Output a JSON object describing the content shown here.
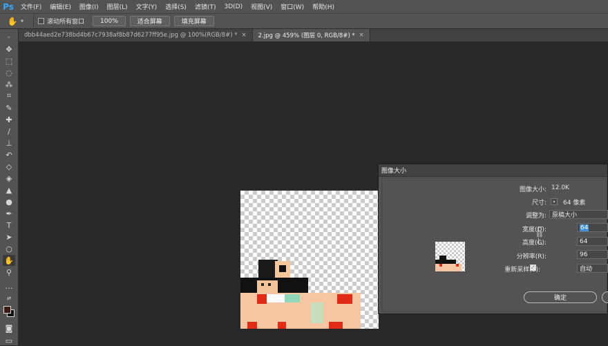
{
  "app": {
    "logo": "Ps",
    "accent": "#31a8ff"
  },
  "menu": [
    "文件(F)",
    "编辑(E)",
    "图像(I)",
    "图层(L)",
    "文字(Y)",
    "选择(S)",
    "滤镜(T)",
    "3D(D)",
    "视图(V)",
    "窗口(W)",
    "帮助(H)"
  ],
  "options": {
    "scroll_all_label": "滚动所有窗口",
    "zoom_value": "100%",
    "fit_screen": "适合屏幕",
    "fill_screen": "填充屏幕"
  },
  "tabs": [
    {
      "label": "dbb44aed2e738bd4b67c7938af8b87d6277ff95e.jpg @ 100%(RGB/8#) *",
      "close": "×"
    },
    {
      "label": "2.jpg @ 459% (图层 0, RGB/8#) *",
      "close": "×"
    }
  ],
  "dialog": {
    "title": "图像大小",
    "image_size_label": "图像大小:",
    "image_size_value": "12.0K",
    "dimension_label": "尺寸:",
    "dimension_value": "64 像素",
    "fit_to_label": "调整为:",
    "fit_to_value": "原稿大小",
    "width_label": "宽度(D):",
    "width_value": "64",
    "height_label": "高度(G):",
    "height_value": "64",
    "resolution_label": "分辨率(R):",
    "resolution_value": "96",
    "resample_label": "重新采样(S):",
    "resample_value": "自动",
    "resample_checked": true,
    "ok_button": "确定"
  }
}
